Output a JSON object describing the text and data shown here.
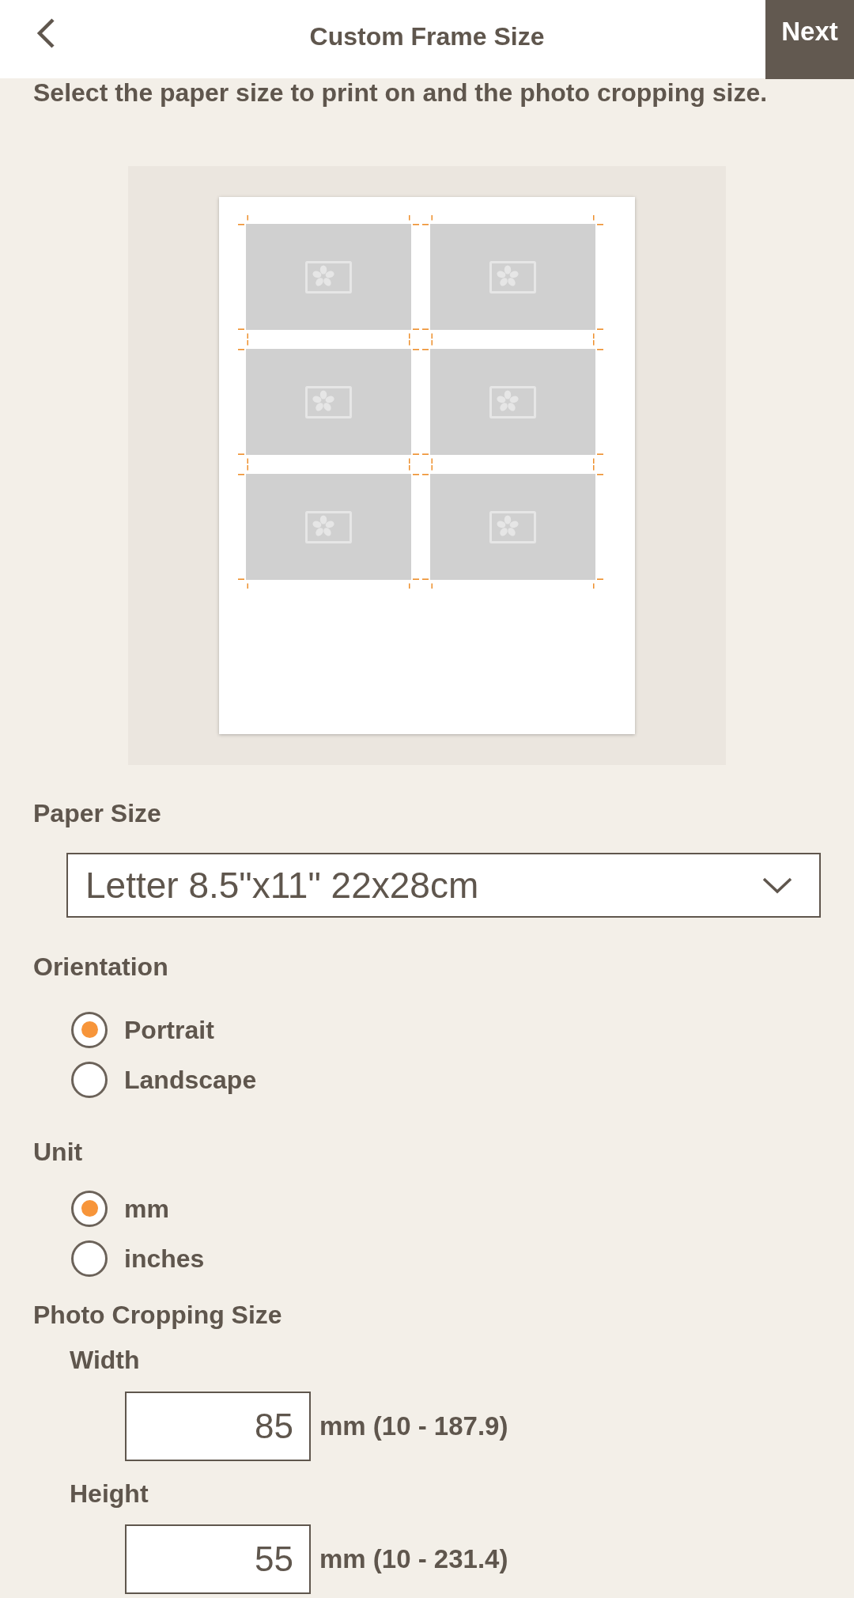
{
  "header": {
    "title": "Custom Frame Size",
    "next_button": "Next"
  },
  "instructions": "Select the paper size to print on and the photo cropping size.",
  "paper_size": {
    "label": "Paper Size",
    "value": "Letter 8.5\"x11\" 22x28cm"
  },
  "orientation": {
    "label": "Orientation",
    "options": [
      {
        "label": "Portrait",
        "selected": true
      },
      {
        "label": "Landscape",
        "selected": false
      }
    ]
  },
  "unit": {
    "label": "Unit",
    "options": [
      {
        "label": "mm",
        "selected": true
      },
      {
        "label": "inches",
        "selected": false
      }
    ]
  },
  "photo_cropping_size": {
    "label": "Photo Cropping Size",
    "fields": [
      {
        "label": "Width",
        "value": "85",
        "range": "mm (10 - 187.9)"
      },
      {
        "label": "Height",
        "value": "55",
        "range": "mm (10 - 231.4)"
      }
    ]
  }
}
